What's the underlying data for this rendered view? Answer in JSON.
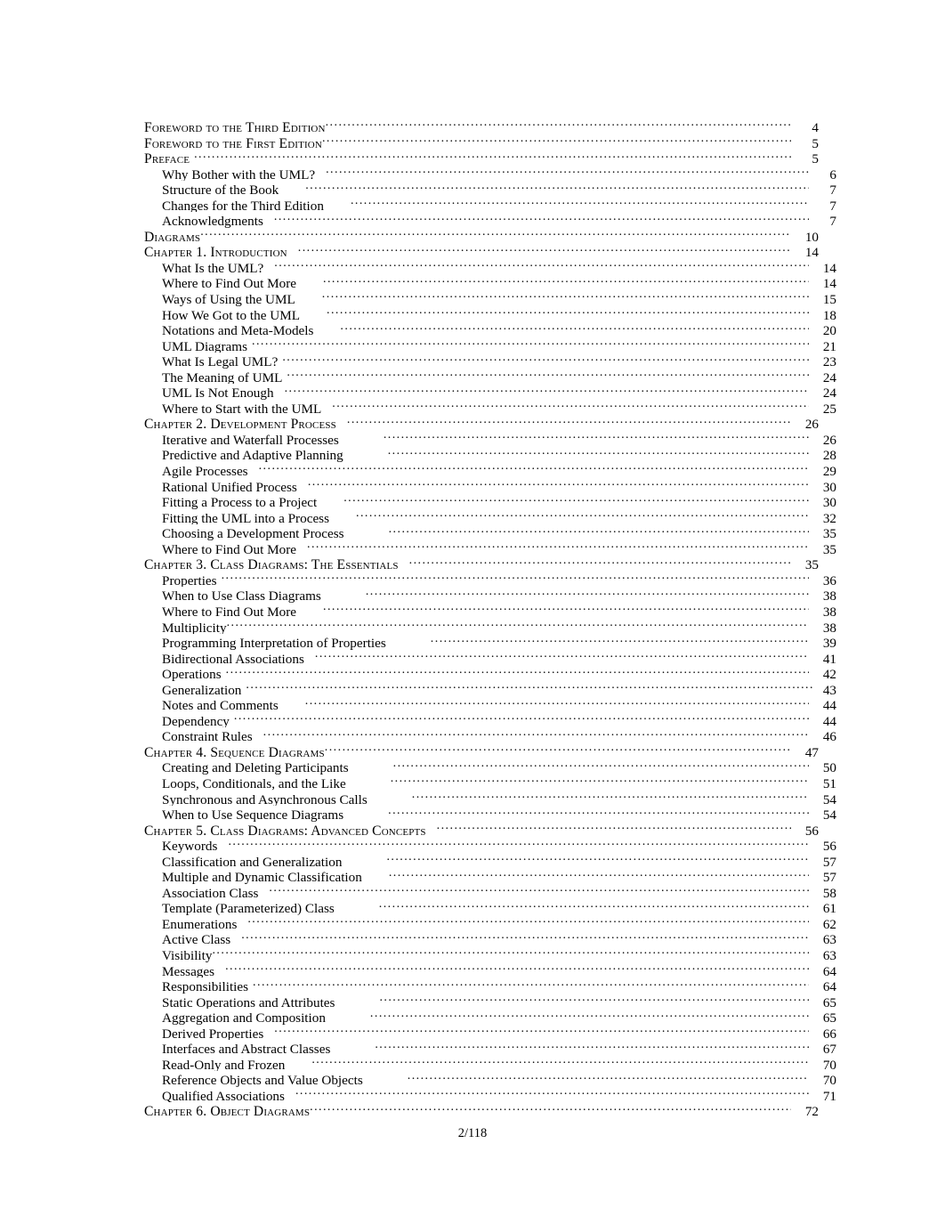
{
  "document": {
    "footer": "2/118"
  },
  "toc": {
    "entries": [
      {
        "title": "Foreword to the   Third Edition",
        "page": "4",
        "level": 1,
        "gap": 0,
        "tight": false
      },
      {
        "title": "Foreword to the   First  Edition",
        "page": "5",
        "level": 1,
        "gap": 0,
        "tight": false
      },
      {
        "title": "Preface",
        "page": "5",
        "level": 1,
        "gap": 1,
        "tight": false
      },
      {
        "title": "Why Bother with the UML?",
        "page": "6",
        "level": 2,
        "gap": 2,
        "tight": false
      },
      {
        "title": "Structure of the Book",
        "page": "7",
        "level": 2,
        "gap": 3,
        "tight": false
      },
      {
        "title": "Changes for the Third Edition",
        "page": "7",
        "level": 2,
        "gap": 3,
        "tight": false
      },
      {
        "title": "Acknowledgments",
        "page": "7",
        "level": 2,
        "gap": 2,
        "tight": false
      },
      {
        "title": "Diagrams",
        "page": "10",
        "level": 1,
        "gap": 0,
        "tight": false
      },
      {
        "title": "Chapter 1. Introduction",
        "page": "14",
        "level": 1,
        "gap": 2,
        "tight": false
      },
      {
        "title": "What Is the UML?",
        "page": "14",
        "level": 2,
        "gap": 2,
        "tight": false
      },
      {
        "title": "Where to Find Out More",
        "page": "14",
        "level": 2,
        "gap": 3,
        "tight": false
      },
      {
        "title": "Ways of Using the UML",
        "page": "15",
        "level": 2,
        "gap": 3,
        "tight": false
      },
      {
        "title": "How We Got to the UML",
        "page": "18",
        "level": 2,
        "gap": 3,
        "tight": false
      },
      {
        "title": "Notations and Meta-Models",
        "page": "20",
        "level": 2,
        "gap": 3,
        "tight": false
      },
      {
        "title": "UML Diagrams",
        "page": "21",
        "level": 2,
        "gap": 1,
        "tight": false
      },
      {
        "title": "What Is Legal UML?",
        "page": "23",
        "level": 2,
        "gap": 1,
        "tight": false
      },
      {
        "title": "The Meaning of UML",
        "page": "24",
        "level": 2,
        "gap": 1,
        "tight": false
      },
      {
        "title": "UML Is Not Enough",
        "page": "24",
        "level": 2,
        "gap": 2,
        "tight": false
      },
      {
        "title": "Where to Start with the UML",
        "page": "25",
        "level": 2,
        "gap": 2,
        "tight": false
      },
      {
        "title": "Chapter 2. Development  Process",
        "page": "26",
        "level": 1,
        "gap": 2,
        "tight": false
      },
      {
        "title": "Iterative and Waterfall Processes",
        "page": "26",
        "level": 2,
        "gap": 4,
        "tight": false
      },
      {
        "title": "Predictive and Adaptive Planning",
        "page": "28",
        "level": 2,
        "gap": 4,
        "tight": false
      },
      {
        "title": "Agile Processes",
        "page": "29",
        "level": 2,
        "gap": 2,
        "tight": false
      },
      {
        "title": "Rational Unified Process",
        "page": "30",
        "level": 2,
        "gap": 2,
        "tight": false
      },
      {
        "title": "Fitting a Process to a Project",
        "page": "30",
        "level": 2,
        "gap": 3,
        "tight": false
      },
      {
        "title": "Fitting the UML into a Process",
        "page": "32",
        "level": 2,
        "gap": 3,
        "tight": false
      },
      {
        "title": "Choosing a Development Process",
        "page": "35",
        "level": 2,
        "gap": 4,
        "tight": false
      },
      {
        "title": "Where to Find Out More",
        "page": "35",
        "level": 2,
        "gap": 2,
        "tight": false
      },
      {
        "title": "Chapter 3. Class Diagrams: The Essentials",
        "page": "35",
        "level": 1,
        "gap": 2,
        "tight": false
      },
      {
        "title": "Properties",
        "page": "36",
        "level": 2,
        "gap": 1,
        "tight": false
      },
      {
        "title": "When to Use Class Diagrams",
        "page": "38",
        "level": 2,
        "gap": 4,
        "tight": false
      },
      {
        "title": "Where to Find Out More",
        "page": "38",
        "level": 2,
        "gap": 3,
        "tight": false
      },
      {
        "title": "Multiplicity",
        "page": "38",
        "level": 2,
        "gap": 0,
        "tight": false
      },
      {
        "title": "Programming Interpretation of Properties",
        "page": "39",
        "level": 2,
        "gap": 4,
        "tight": false
      },
      {
        "title": "Bidirectional Associations",
        "page": "41",
        "level": 2,
        "gap": 2,
        "tight": false
      },
      {
        "title": "Operations",
        "page": "42",
        "level": 2,
        "gap": 1,
        "tight": false
      },
      {
        "title": "Generalization",
        "page": "43",
        "level": 2,
        "gap": 1,
        "tight": true
      },
      {
        "title": "Notes and Comments",
        "page": "44",
        "level": 2,
        "gap": 3,
        "tight": false
      },
      {
        "title": "Dependency",
        "page": "44",
        "level": 2,
        "gap": 1,
        "tight": false
      },
      {
        "title": "Constraint Rules",
        "page": "46",
        "level": 2,
        "gap": 2,
        "tight": false
      },
      {
        "title": "Chapter 4. Sequence  Diagrams",
        "page": "47",
        "level": 1,
        "gap": 0,
        "tight": false
      },
      {
        "title": "Creating and Deleting Participants",
        "page": "50",
        "level": 2,
        "gap": 4,
        "tight": false
      },
      {
        "title": "Loops, Conditionals, and the Like",
        "page": "51",
        "level": 2,
        "gap": 4,
        "tight": false
      },
      {
        "title": "Synchronous and Asynchronous Calls",
        "page": "54",
        "level": 2,
        "gap": 4,
        "tight": false
      },
      {
        "title": "When to Use Sequence Diagrams",
        "page": "54",
        "level": 2,
        "gap": 4,
        "tight": false
      },
      {
        "title": "Chapter 5. Class Diagrams: Advanced Concepts",
        "page": "56",
        "level": 1,
        "gap": 2,
        "tight": false
      },
      {
        "title": "Keywords",
        "page": "56",
        "level": 2,
        "gap": 2,
        "tight": false
      },
      {
        "title": "Classification and Generalization",
        "page": "57",
        "level": 2,
        "gap": 4,
        "tight": false
      },
      {
        "title": "Multiple and Dynamic Classification",
        "page": "57",
        "level": 2,
        "gap": 3,
        "tight": false
      },
      {
        "title": "Association Class",
        "page": "58",
        "level": 2,
        "gap": 2,
        "tight": false
      },
      {
        "title": "Template (Parameterized) Class",
        "page": "61",
        "level": 2,
        "gap": 4,
        "tight": false
      },
      {
        "title": "Enumerations",
        "page": "62",
        "level": 2,
        "gap": 2,
        "tight": false
      },
      {
        "title": "Active Class",
        "page": "63",
        "level": 2,
        "gap": 2,
        "tight": false
      },
      {
        "title": "Visibility",
        "page": "63",
        "level": 2,
        "gap": 0,
        "tight": false
      },
      {
        "title": "Messages",
        "page": "64",
        "level": 2,
        "gap": 2,
        "tight": false
      },
      {
        "title": "Responsibilities",
        "page": "64",
        "level": 2,
        "gap": 1,
        "tight": false
      },
      {
        "title": "Static Operations and Attributes",
        "page": "65",
        "level": 2,
        "gap": 4,
        "tight": false
      },
      {
        "title": "Aggregation and Composition",
        "page": "65",
        "level": 2,
        "gap": 4,
        "tight": false
      },
      {
        "title": "Derived Properties",
        "page": "66",
        "level": 2,
        "gap": 2,
        "tight": false
      },
      {
        "title": "Interfaces and Abstract Classes",
        "page": "67",
        "level": 2,
        "gap": 4,
        "tight": false
      },
      {
        "title": "Read-Only and Frozen",
        "page": "70",
        "level": 2,
        "gap": 3,
        "tight": false
      },
      {
        "title": "Reference Objects and Value Objects",
        "page": "70",
        "level": 2,
        "gap": 4,
        "tight": false
      },
      {
        "title": "Qualified Associations",
        "page": "71",
        "level": 2,
        "gap": 2,
        "tight": false
      },
      {
        "title": "Chapter 6. Object  Diagrams",
        "page": "72",
        "level": 1,
        "gap": 0,
        "tight": false
      }
    ]
  }
}
